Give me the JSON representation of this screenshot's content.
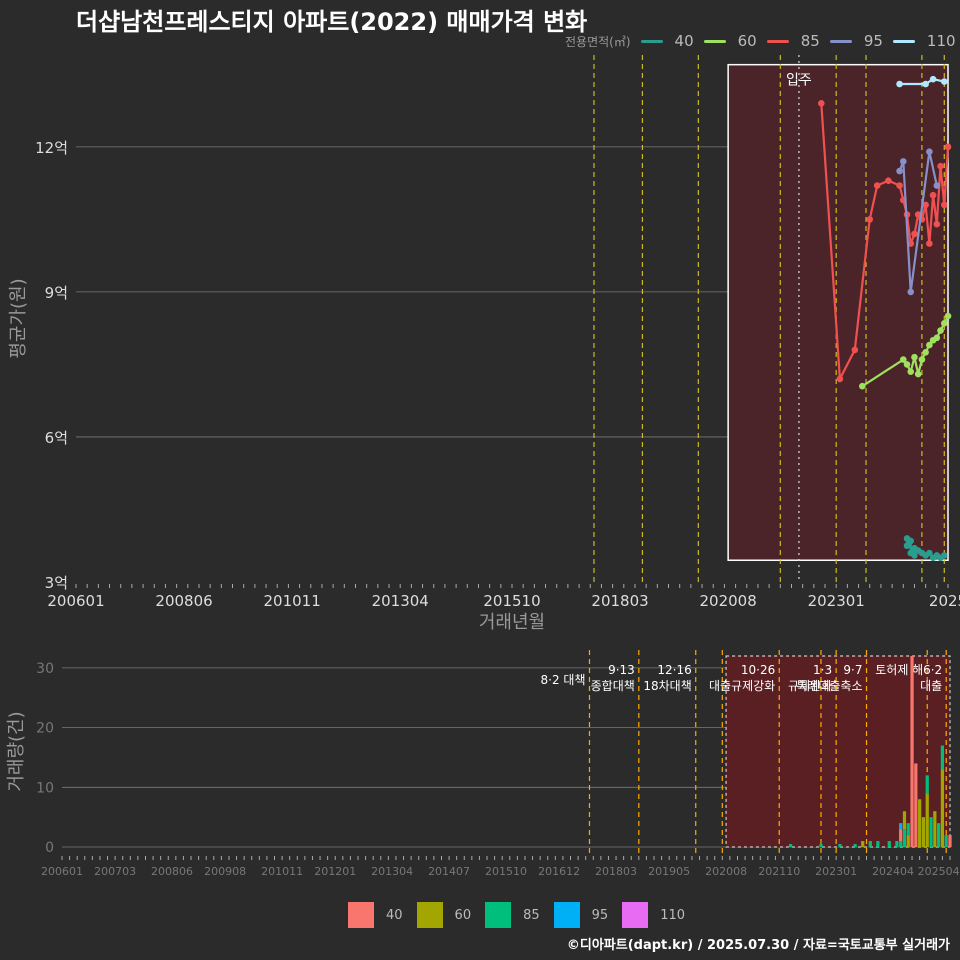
{
  "title": "더샵남천프레스티지 아파트(2022) 매매가격 변화",
  "caption": "©디아파트(dapt.kr) / 2025.07.30 / 자료=국토교통부 실거래가",
  "colors": {
    "background": "#2b2b2b",
    "grid": "#7a7a7a",
    "policy_line": "#ccbb22",
    "policy_line_bottom": "#ffaa00",
    "highlight_fill": "#4a2428",
    "highlight_fill_bottom": "#5a1f22"
  },
  "chart_data": [
    {
      "type": "line",
      "title": "더샵남천프레스티지 아파트(2022) 매매가격 변화",
      "xlabel": "거래년월",
      "ylabel": "평균가(원)",
      "x_tick_labels": [
        "200601",
        "200806",
        "201011",
        "201304",
        "201510",
        "201803",
        "202008",
        "202301",
        "2025"
      ],
      "x_range": [
        "2006-01",
        "2025-07"
      ],
      "y_tick_labels": [
        "3억",
        "6억",
        "9억",
        "12억"
      ],
      "y_ticks": [
        3,
        6,
        9,
        12
      ],
      "ylim": [
        3,
        13.9
      ],
      "y_unit": "억",
      "grid": true,
      "legend": {
        "title": "전용면적(㎡)",
        "position": "top-right",
        "entries": [
          {
            "label": "40",
            "color": "#2a9d8f"
          },
          {
            "label": "60",
            "color": "#9fe060"
          },
          {
            "label": "85",
            "color": "#f05050"
          },
          {
            "label": "95",
            "color": "#8890c8"
          },
          {
            "label": "110",
            "color": "#b0e8ff"
          }
        ]
      },
      "policy_lines": [
        "2017-08",
        "2018-09",
        "2019-12",
        "2021-10",
        "2023-01",
        "2023-09",
        "2024-12",
        "2025-06"
      ],
      "movein": {
        "label": "입주",
        "date": "2022-03"
      },
      "highlight": {
        "from": "2020-08",
        "to": "2025-07",
        "ymin": 3.45,
        "ymax": 13.7
      },
      "series": [
        {
          "name": "40",
          "color": "#2a9d8f",
          "points": [
            [
              "2024-08",
              3.9
            ],
            [
              "2024-08",
              3.75
            ],
            [
              "2024-09",
              3.85
            ],
            [
              "2024-09",
              3.6
            ],
            [
              "2024-10",
              3.7
            ],
            [
              "2024-10",
              3.55
            ],
            [
              "2024-11",
              3.65
            ],
            [
              "2024-12",
              3.6
            ],
            [
              "2025-01",
              3.55
            ],
            [
              "2025-02",
              3.6
            ],
            [
              "2025-03",
              3.5
            ],
            [
              "2025-04",
              3.55
            ],
            [
              "2025-05",
              3.5
            ],
            [
              "2025-06",
              3.55
            ]
          ]
        },
        {
          "name": "60",
          "color": "#9fe060",
          "points": [
            [
              "2023-08",
              7.05
            ],
            [
              "2024-07",
              7.6
            ],
            [
              "2024-08",
              7.5
            ],
            [
              "2024-09",
              7.35
            ],
            [
              "2024-10",
              7.65
            ],
            [
              "2024-11",
              7.3
            ],
            [
              "2024-12",
              7.6
            ],
            [
              "2025-01",
              7.75
            ],
            [
              "2025-02",
              7.9
            ],
            [
              "2025-03",
              8.0
            ],
            [
              "2025-04",
              8.05
            ],
            [
              "2025-05",
              8.2
            ],
            [
              "2025-06",
              8.35
            ],
            [
              "2025-07",
              8.5
            ]
          ]
        },
        {
          "name": "85",
          "color": "#f05050",
          "points": [
            [
              "2022-09",
              12.9
            ],
            [
              "2023-02",
              7.2
            ],
            [
              "2023-06",
              7.8
            ],
            [
              "2023-10",
              10.5
            ],
            [
              "2023-12",
              11.2
            ],
            [
              "2024-03",
              11.3
            ],
            [
              "2024-06",
              11.2
            ],
            [
              "2024-07",
              10.9
            ],
            [
              "2024-08",
              10.6
            ],
            [
              "2024-09",
              10.0
            ],
            [
              "2024-10",
              10.2
            ],
            [
              "2024-11",
              10.6
            ],
            [
              "2024-12",
              10.5
            ],
            [
              "2025-01",
              10.8
            ],
            [
              "2025-02",
              10.0
            ],
            [
              "2025-03",
              11.0
            ],
            [
              "2025-04",
              10.4
            ],
            [
              "2025-05",
              11.6
            ],
            [
              "2025-06",
              10.8
            ],
            [
              "2025-07",
              12.0
            ]
          ]
        },
        {
          "name": "95",
          "color": "#8890c8",
          "points": [
            [
              "2024-06",
              11.5
            ],
            [
              "2024-07",
              11.7
            ],
            [
              "2024-09",
              9.0
            ],
            [
              "2025-02",
              11.9
            ],
            [
              "2025-04",
              11.2
            ]
          ]
        },
        {
          "name": "110",
          "color": "#b0e8ff",
          "points": [
            [
              "2024-06",
              13.3
            ],
            [
              "2025-01",
              13.3
            ],
            [
              "2025-03",
              13.4
            ],
            [
              "2025-06",
              13.35
            ]
          ]
        }
      ]
    },
    {
      "type": "bar",
      "xlabel": "",
      "ylabel": "거래량(건)",
      "x_tick_labels": [
        "200601",
        "200703",
        "200806",
        "200908",
        "201011",
        "201201",
        "201304",
        "201407",
        "201510",
        "201612",
        "201803",
        "201905",
        "202008",
        "202110",
        "202301",
        "202404",
        "202504"
      ],
      "y_ticks": [
        0,
        10,
        20,
        30
      ],
      "ylim": [
        -1,
        33
      ],
      "grid": true,
      "legend": {
        "position": "bottom",
        "entries": [
          {
            "label": "40",
            "color": "#f8766d"
          },
          {
            "label": "60",
            "color": "#a3a500"
          },
          {
            "label": "85",
            "color": "#00bf7d"
          },
          {
            "label": "95",
            "color": "#00b0f6"
          },
          {
            "label": "110",
            "color": "#e76bf3"
          }
        ]
      },
      "policy_lines": [
        "2017-08",
        "2018-09",
        "2019-12",
        "2020-07",
        "2021-10",
        "2022-09",
        "2023-01",
        "2023-09",
        "2025-01",
        "2025-06"
      ],
      "annotations": [
        {
          "date": "2017-08",
          "lines": [
            "8·2 대책"
          ]
        },
        {
          "date": "2018-09",
          "lines": [
            "9·13",
            "종합대책"
          ]
        },
        {
          "date": "2019-12",
          "lines": [
            "12·16",
            "18차대책"
          ]
        },
        {
          "date": "2021-10",
          "lines": [
            "10·26",
            "대출규제강화"
          ]
        },
        {
          "date": "2023-01",
          "lines": [
            "1·3",
            "규제완화"
          ]
        },
        {
          "date": "2023-09",
          "lines": [
            "9·7",
            "특례대출축소"
          ]
        },
        {
          "date": "2025-01",
          "lines": [
            "토허제 해"
          ]
        },
        {
          "date": "2025-06",
          "lines": [
            "6·2",
            "대출"
          ]
        }
      ],
      "highlight": {
        "from": "2020-08",
        "to": "2025-07",
        "ymin": 0,
        "ymax": 32
      },
      "bars": [
        {
          "date": "2022-01",
          "series": "85",
          "value": 0.5
        },
        {
          "date": "2022-09",
          "series": "85",
          "value": 0.5
        },
        {
          "date": "2023-02",
          "series": "85",
          "value": 0.5
        },
        {
          "date": "2023-06",
          "series": "85",
          "value": 0.5
        },
        {
          "date": "2023-08",
          "series": "60",
          "value": 1
        },
        {
          "date": "2023-10",
          "series": "85",
          "value": 1
        },
        {
          "date": "2023-12",
          "series": "85",
          "value": 1
        },
        {
          "date": "2024-03",
          "series": "85",
          "value": 1
        },
        {
          "date": "2024-05",
          "series": "85",
          "value": 1
        },
        {
          "date": "2024-06",
          "series": "85",
          "value": 1
        },
        {
          "date": "2024-06",
          "series": "40",
          "value": 2
        },
        {
          "date": "2024-06",
          "series": "95",
          "value": 1
        },
        {
          "date": "2024-07",
          "series": "85",
          "value": 3
        },
        {
          "date": "2024-07",
          "series": "60",
          "value": 3
        },
        {
          "date": "2024-08",
          "series": "60",
          "value": 2
        },
        {
          "date": "2024-08",
          "series": "85",
          "value": 2
        },
        {
          "date": "2024-09",
          "series": "40",
          "value": 32
        },
        {
          "date": "2024-10",
          "series": "40",
          "value": 14
        },
        {
          "date": "2024-11",
          "series": "60",
          "value": 8
        },
        {
          "date": "2024-12",
          "series": "60",
          "value": 5
        },
        {
          "date": "2025-01",
          "series": "60",
          "value": 9
        },
        {
          "date": "2025-01",
          "series": "85",
          "value": 3
        },
        {
          "date": "2025-02",
          "series": "85",
          "value": 5
        },
        {
          "date": "2025-03",
          "series": "60",
          "value": 6
        },
        {
          "date": "2025-04",
          "series": "85",
          "value": 4
        },
        {
          "date": "2025-05",
          "series": "60",
          "value": 13
        },
        {
          "date": "2025-05",
          "series": "85",
          "value": 4
        },
        {
          "date": "2025-06",
          "series": "85",
          "value": 2
        },
        {
          "date": "2025-07",
          "series": "40",
          "value": 2
        }
      ]
    }
  ]
}
